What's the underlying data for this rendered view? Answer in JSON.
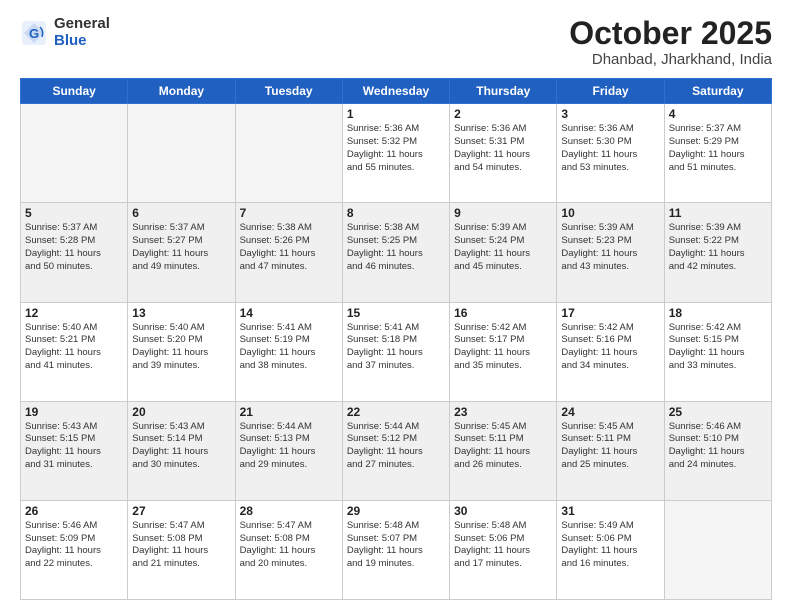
{
  "logo": {
    "general": "General",
    "blue": "Blue"
  },
  "title": {
    "month_year": "October 2025",
    "location": "Dhanbad, Jharkhand, India"
  },
  "weekdays": [
    "Sunday",
    "Monday",
    "Tuesday",
    "Wednesday",
    "Thursday",
    "Friday",
    "Saturday"
  ],
  "weeks": [
    [
      {
        "day": "",
        "info": ""
      },
      {
        "day": "",
        "info": ""
      },
      {
        "day": "",
        "info": ""
      },
      {
        "day": "1",
        "info": "Sunrise: 5:36 AM\nSunset: 5:32 PM\nDaylight: 11 hours\nand 55 minutes."
      },
      {
        "day": "2",
        "info": "Sunrise: 5:36 AM\nSunset: 5:31 PM\nDaylight: 11 hours\nand 54 minutes."
      },
      {
        "day": "3",
        "info": "Sunrise: 5:36 AM\nSunset: 5:30 PM\nDaylight: 11 hours\nand 53 minutes."
      },
      {
        "day": "4",
        "info": "Sunrise: 5:37 AM\nSunset: 5:29 PM\nDaylight: 11 hours\nand 51 minutes."
      }
    ],
    [
      {
        "day": "5",
        "info": "Sunrise: 5:37 AM\nSunset: 5:28 PM\nDaylight: 11 hours\nand 50 minutes."
      },
      {
        "day": "6",
        "info": "Sunrise: 5:37 AM\nSunset: 5:27 PM\nDaylight: 11 hours\nand 49 minutes."
      },
      {
        "day": "7",
        "info": "Sunrise: 5:38 AM\nSunset: 5:26 PM\nDaylight: 11 hours\nand 47 minutes."
      },
      {
        "day": "8",
        "info": "Sunrise: 5:38 AM\nSunset: 5:25 PM\nDaylight: 11 hours\nand 46 minutes."
      },
      {
        "day": "9",
        "info": "Sunrise: 5:39 AM\nSunset: 5:24 PM\nDaylight: 11 hours\nand 45 minutes."
      },
      {
        "day": "10",
        "info": "Sunrise: 5:39 AM\nSunset: 5:23 PM\nDaylight: 11 hours\nand 43 minutes."
      },
      {
        "day": "11",
        "info": "Sunrise: 5:39 AM\nSunset: 5:22 PM\nDaylight: 11 hours\nand 42 minutes."
      }
    ],
    [
      {
        "day": "12",
        "info": "Sunrise: 5:40 AM\nSunset: 5:21 PM\nDaylight: 11 hours\nand 41 minutes."
      },
      {
        "day": "13",
        "info": "Sunrise: 5:40 AM\nSunset: 5:20 PM\nDaylight: 11 hours\nand 39 minutes."
      },
      {
        "day": "14",
        "info": "Sunrise: 5:41 AM\nSunset: 5:19 PM\nDaylight: 11 hours\nand 38 minutes."
      },
      {
        "day": "15",
        "info": "Sunrise: 5:41 AM\nSunset: 5:18 PM\nDaylight: 11 hours\nand 37 minutes."
      },
      {
        "day": "16",
        "info": "Sunrise: 5:42 AM\nSunset: 5:17 PM\nDaylight: 11 hours\nand 35 minutes."
      },
      {
        "day": "17",
        "info": "Sunrise: 5:42 AM\nSunset: 5:16 PM\nDaylight: 11 hours\nand 34 minutes."
      },
      {
        "day": "18",
        "info": "Sunrise: 5:42 AM\nSunset: 5:15 PM\nDaylight: 11 hours\nand 33 minutes."
      }
    ],
    [
      {
        "day": "19",
        "info": "Sunrise: 5:43 AM\nSunset: 5:15 PM\nDaylight: 11 hours\nand 31 minutes."
      },
      {
        "day": "20",
        "info": "Sunrise: 5:43 AM\nSunset: 5:14 PM\nDaylight: 11 hours\nand 30 minutes."
      },
      {
        "day": "21",
        "info": "Sunrise: 5:44 AM\nSunset: 5:13 PM\nDaylight: 11 hours\nand 29 minutes."
      },
      {
        "day": "22",
        "info": "Sunrise: 5:44 AM\nSunset: 5:12 PM\nDaylight: 11 hours\nand 27 minutes."
      },
      {
        "day": "23",
        "info": "Sunrise: 5:45 AM\nSunset: 5:11 PM\nDaylight: 11 hours\nand 26 minutes."
      },
      {
        "day": "24",
        "info": "Sunrise: 5:45 AM\nSunset: 5:11 PM\nDaylight: 11 hours\nand 25 minutes."
      },
      {
        "day": "25",
        "info": "Sunrise: 5:46 AM\nSunset: 5:10 PM\nDaylight: 11 hours\nand 24 minutes."
      }
    ],
    [
      {
        "day": "26",
        "info": "Sunrise: 5:46 AM\nSunset: 5:09 PM\nDaylight: 11 hours\nand 22 minutes."
      },
      {
        "day": "27",
        "info": "Sunrise: 5:47 AM\nSunset: 5:08 PM\nDaylight: 11 hours\nand 21 minutes."
      },
      {
        "day": "28",
        "info": "Sunrise: 5:47 AM\nSunset: 5:08 PM\nDaylight: 11 hours\nand 20 minutes."
      },
      {
        "day": "29",
        "info": "Sunrise: 5:48 AM\nSunset: 5:07 PM\nDaylight: 11 hours\nand 19 minutes."
      },
      {
        "day": "30",
        "info": "Sunrise: 5:48 AM\nSunset: 5:06 PM\nDaylight: 11 hours\nand 17 minutes."
      },
      {
        "day": "31",
        "info": "Sunrise: 5:49 AM\nSunset: 5:06 PM\nDaylight: 11 hours\nand 16 minutes."
      },
      {
        "day": "",
        "info": ""
      }
    ]
  ]
}
